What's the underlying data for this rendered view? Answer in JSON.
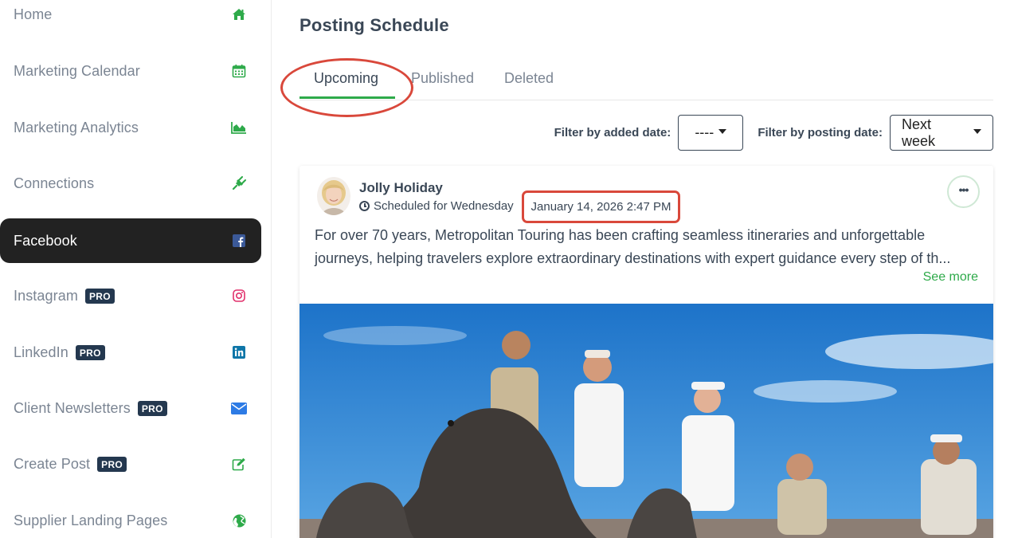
{
  "sidebar": {
    "items": [
      {
        "label": "Home",
        "pro": "",
        "icon": "home-icon"
      },
      {
        "label": "Marketing Calendar",
        "pro": "",
        "icon": "calendar-icon"
      },
      {
        "label": "Marketing Analytics",
        "pro": "",
        "icon": "area-chart-icon"
      },
      {
        "label": "Connections",
        "pro": "",
        "icon": "plug-icon"
      },
      {
        "label": "Facebook",
        "pro": "",
        "icon": "facebook-icon",
        "active": true
      },
      {
        "label": "Instagram",
        "pro": "PRO",
        "icon": "instagram-icon"
      },
      {
        "label": "LinkedIn",
        "pro": "PRO",
        "icon": "linkedin-icon"
      },
      {
        "label": "Client Newsletters",
        "pro": "PRO",
        "icon": "envelope-icon"
      },
      {
        "label": "Create Post",
        "pro": "PRO",
        "icon": "edit-icon"
      },
      {
        "label": "Supplier Landing Pages",
        "pro": "",
        "icon": "globe-icon"
      }
    ]
  },
  "main": {
    "title": "Posting Schedule",
    "tabs": [
      {
        "label": "Upcoming",
        "active": true
      },
      {
        "label": "Published"
      },
      {
        "label": "Deleted"
      }
    ],
    "filters": {
      "added_label": "Filter by added date:",
      "added_value": "----",
      "posting_label": "Filter by posting date:",
      "posting_value": "Next week"
    },
    "post": {
      "author": "Jolly Holiday",
      "scheduled_prefix": "Scheduled for Wednesday",
      "scheduled_date": "January 14, 2026 2:47 PM",
      "text": "For over 70 years, Metropolitan Touring has been crafting seamless itineraries and unforgettable journeys, helping travelers explore extraordinary destinations with expert guidance every step of th...",
      "see_more": "See more",
      "more_icon": "ellipsis-icon"
    }
  },
  "colors": {
    "accent_green": "#2eaa4a",
    "annotation_red": "#d9483b",
    "active_nav": "#222222",
    "pro_badge": "#24384f",
    "facebook_blue": "#3b5998"
  }
}
